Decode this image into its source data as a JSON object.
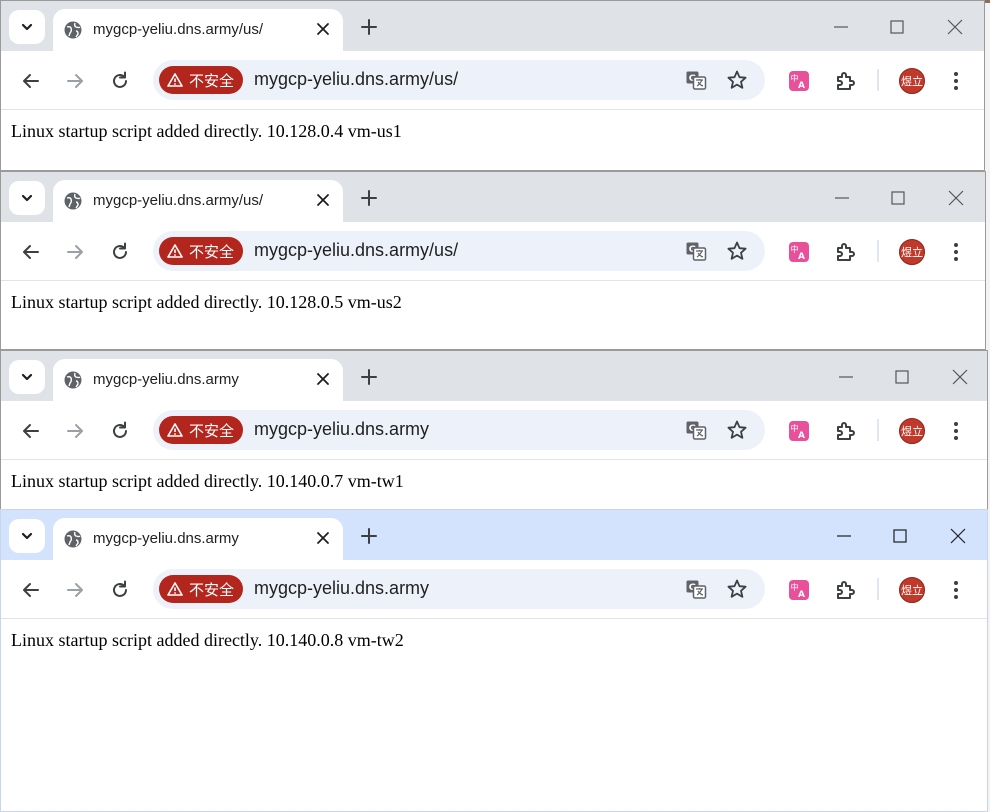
{
  "windows": [
    {
      "tab_title": "mygcp-yeliu.dns.army/us/",
      "security_chip": "不安全",
      "url": "mygcp-yeliu.dns.army/us/",
      "page_text": "Linux startup script added directly. 10.128.0.4 vm-us1",
      "avatar_text": "煜立",
      "active": false
    },
    {
      "tab_title": "mygcp-yeliu.dns.army/us/",
      "security_chip": "不安全",
      "url": "mygcp-yeliu.dns.army/us/",
      "page_text": "Linux startup script added directly. 10.128.0.5 vm-us2",
      "avatar_text": "煜立",
      "active": false
    },
    {
      "tab_title": "mygcp-yeliu.dns.army",
      "security_chip": "不安全",
      "url": "mygcp-yeliu.dns.army",
      "page_text": "Linux startup script added directly. 10.140.0.7 vm-tw1",
      "avatar_text": "煜立",
      "active": false
    },
    {
      "tab_title": "mygcp-yeliu.dns.army",
      "security_chip": "不安全",
      "url": "mygcp-yeliu.dns.army",
      "page_text": "Linux startup script added directly. 10.140.0.8 vm-tw2",
      "avatar_text": "煜立",
      "active": true
    }
  ],
  "colors": {
    "insecure_chip": "#b3261e",
    "tabbar_inactive": "#dfe3e8",
    "tabbar_active": "#d3e3fd",
    "omnibox": "#edf2fa",
    "avatar": "#c0392b"
  },
  "icons": {
    "tab_search": "chevron-down-icon",
    "favicon": "globe-icon",
    "tab_close": "close-icon",
    "new_tab": "plus-icon",
    "back": "arrow-left-icon",
    "forward": "arrow-right-icon",
    "reload": "reload-icon",
    "warning": "warning-triangle-icon",
    "translate": "translate-icon",
    "bookmark": "star-icon",
    "extension_translate": "pink-translate-extension-icon",
    "extensions": "puzzle-icon",
    "menu": "kebab-menu-icon",
    "minimize": "minimize-icon",
    "maximize": "maximize-icon",
    "close_window": "close-window-icon"
  }
}
